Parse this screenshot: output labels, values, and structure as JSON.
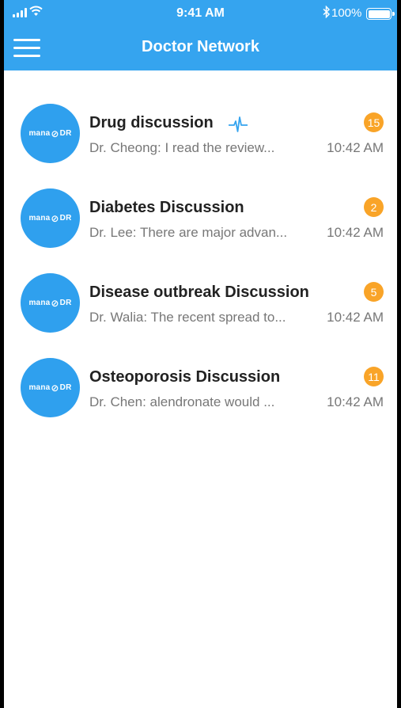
{
  "status_bar": {
    "time": "9:41 AM",
    "battery": "100%"
  },
  "header": {
    "title": "Doctor Network"
  },
  "avatar_logo": {
    "left": "mana",
    "right": "DR"
  },
  "chats": [
    {
      "name": "Drug discussion",
      "preview": "Dr. Cheong: I read the review...",
      "time": "10:42 AM",
      "badge": "15",
      "pulse": true
    },
    {
      "name": "Diabetes Discussion",
      "preview": "Dr. Lee: There are major advan...",
      "time": "10:42 AM",
      "badge": "2"
    },
    {
      "name": "Disease outbreak Discussion",
      "preview": "Dr. Walia: The recent spread to...",
      "time": "10:42 AM",
      "badge": "5"
    },
    {
      "name": "Osteoporosis Discussion",
      "preview": "Dr. Chen: alendronate would ...",
      "time": "10:42 AM",
      "badge": "11"
    }
  ],
  "colors": {
    "accent": "#35a4ef",
    "badge": "#f9a428",
    "avatar": "#2fa0ee"
  }
}
